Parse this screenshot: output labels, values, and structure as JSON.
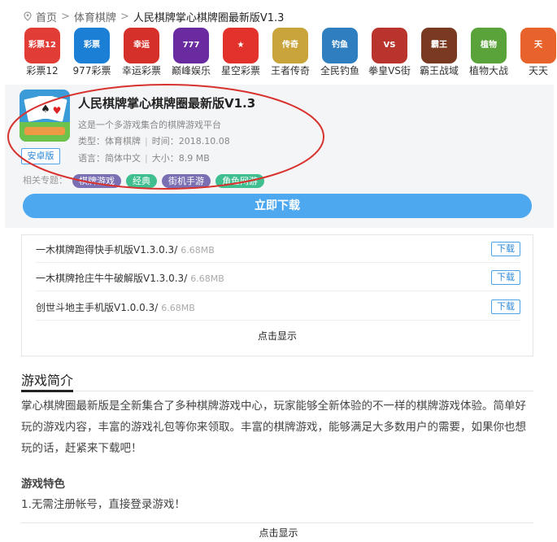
{
  "breadcrumb": {
    "home": "首页",
    "category": "体育棋牌",
    "current": "人民棋牌掌心棋牌圈最新版V1.3",
    "sep": ">"
  },
  "apps": [
    {
      "name": "彩票12",
      "icon": "caipiao12-icon",
      "color": "#e23c36",
      "text": "彩票12"
    },
    {
      "name": "977彩票",
      "icon": "977-icon",
      "color": "#1b7fd6",
      "text": "彩票"
    },
    {
      "name": "幸运彩票",
      "icon": "xingyun-icon",
      "color": "#d6302b",
      "text": "幸运"
    },
    {
      "name": "巅峰娱乐",
      "icon": "dianfeng-icon",
      "color": "#6a2ba0",
      "text": "777"
    },
    {
      "name": "星空彩票",
      "icon": "xingkong-icon",
      "color": "#e3322c",
      "text": "★"
    },
    {
      "name": "王者传奇",
      "icon": "wangzhe-icon",
      "color": "#c9a43a",
      "text": "传奇"
    },
    {
      "name": "全民钓鱼",
      "icon": "diaoyu-icon",
      "color": "#2f7fc0",
      "text": "钓鱼"
    },
    {
      "name": "拳皇VS街",
      "icon": "quanhuang-icon",
      "color": "#b8342c",
      "text": "VS"
    },
    {
      "name": "霸王战域",
      "icon": "bawang-icon",
      "color": "#7a3a22",
      "text": "霸王"
    },
    {
      "name": "植物大战",
      "icon": "zhiwu-icon",
      "color": "#5aa33a",
      "text": "植物"
    },
    {
      "name": "天天",
      "icon": "tiantian-icon",
      "color": "#e8622c",
      "text": "天"
    }
  ],
  "game": {
    "title": "人民棋牌掌心棋牌圈最新版V1.3",
    "desc": "这是一个多游戏集合的棋牌游戏平台",
    "type_label": "类型：体育棋牌",
    "time_label": "时间：2018.10.08",
    "lang_label": "语言：简体中文",
    "size_label": "大小：8.9 MB",
    "platform_badge": "安卓版",
    "tags_label": "相关专题：",
    "tags": [
      {
        "text": "棋牌游戏",
        "color": "#7a6fb3"
      },
      {
        "text": "经典",
        "color": "#3fbf8f"
      },
      {
        "text": "街机手游",
        "color": "#7a6fb3"
      },
      {
        "text": "角色网游",
        "color": "#3fbf8f"
      }
    ],
    "download_label": "立即下载"
  },
  "downloads": [
    {
      "name": "一木棋牌跑得快手机版V1.3.0.3/",
      "size": "6.68MB",
      "btn": "下载"
    },
    {
      "name": "一木棋牌抢庄牛牛破解版V1.3.0.3/",
      "size": "6.68MB",
      "btn": "下载"
    },
    {
      "name": "创世斗地主手机版V1.0.0.3/",
      "size": "6.68MB",
      "btn": "下载"
    }
  ],
  "show_more": "点击显示",
  "intro": {
    "heading": "游戏简介",
    "text": "掌心棋牌圈最新版是全新集合了多种棋牌游戏中心，玩家能够全新体验的不一样的棋牌游戏体验。简单好玩的游戏内容，丰富的游戏礼包等你来领取。丰富的棋牌游戏，能够满足大多数用户的需要，如果你也想玩的话，赶紧来下载吧！",
    "features_heading": "游戏特色",
    "feature_1": "1.无需注册帐号，直接登录游戏！"
  },
  "colors": {
    "accent": "#4ea8ef",
    "annotation": "#d8322f"
  }
}
